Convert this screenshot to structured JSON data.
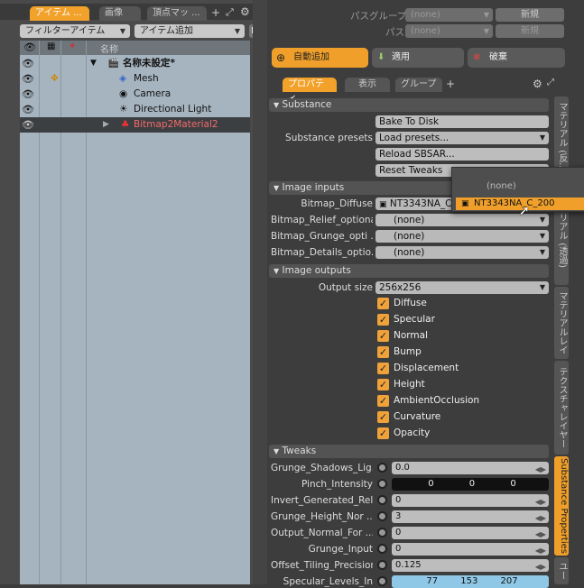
{
  "left": {
    "tabs": [
      "アイテム ...",
      "画像",
      "頂点マッ ..."
    ],
    "filter_combo": "フィルターアイテム",
    "add_combo": "アイテム追加",
    "f_button": "F",
    "column_header": "名称",
    "items": [
      {
        "label": "名称未設定*",
        "icon": "scene-icon"
      },
      {
        "label": "Mesh",
        "icon": "mesh-icon"
      },
      {
        "label": "Camera",
        "icon": "camera-icon"
      },
      {
        "label": "Directional Light",
        "icon": "light-icon"
      },
      {
        "label": "Bitmap2Material2",
        "icon": "substance-icon"
      }
    ]
  },
  "right": {
    "pass_group_label": "パスグループ",
    "pass_label": "パス",
    "none": "(none)",
    "new_button": "新規",
    "auto_add": "自動追加",
    "apply": "適用",
    "discard": "破棄",
    "tabs": [
      "プロパティ",
      "表示",
      "グループ"
    ],
    "plus": "+",
    "substance_section": "Substance",
    "bake_to_disk": "Bake To Disk",
    "substance_presets_label": "Substance presets",
    "load_presets": "Load presets...",
    "reload_sbsar": "Reload SBSAR...",
    "reset_tweaks": "Reset Tweaks",
    "image_inputs_section": "Image inputs",
    "inputs": [
      {
        "label": "Bitmap_Diffuse",
        "value": "NT3343NA_C"
      },
      {
        "label": "Bitmap_Relief_optional",
        "value": "(none)"
      },
      {
        "label": "Bitmap_Grunge_opti ...",
        "value": "(none)"
      },
      {
        "label": "Bitmap_Details_optio...",
        "value": "(none)"
      }
    ],
    "dropdown": {
      "none": "(none)",
      "selected": "NT3343NA_C_200"
    },
    "image_outputs_section": "Image outputs",
    "output_size_label": "Output size",
    "output_size": "256x256",
    "outputs": [
      "Diffuse",
      "Specular",
      "Normal",
      "Bump",
      "Displacement",
      "Height",
      "AmbientOcclusion",
      "Curvature",
      "Opacity"
    ],
    "tweaks_section": "Tweaks",
    "tweaks": [
      {
        "label": "Grunge_Shadows_Lig...",
        "value": "0.0"
      },
      {
        "label": "Pinch_Intensity",
        "value": "0  0  0"
      },
      {
        "label": "Invert_Generated_Rel...",
        "value": "0"
      },
      {
        "label": "Grunge_Height_Nor ...",
        "value": "3"
      },
      {
        "label": "Output_Normal_For ...",
        "value": "0"
      },
      {
        "label": "Grunge_Input",
        "value": "0"
      },
      {
        "label": "Offset_Tiling_Precision",
        "value": "0.125"
      },
      {
        "label": "Specular_Levels_In",
        "value": "77  153  207"
      }
    ],
    "vtabs": [
      "マテリアル (反...",
      "マテリアル (透過)",
      "マテリアルレイ",
      "テクスチャレイヤー",
      "Substance Properties",
      "ユー"
    ]
  }
}
